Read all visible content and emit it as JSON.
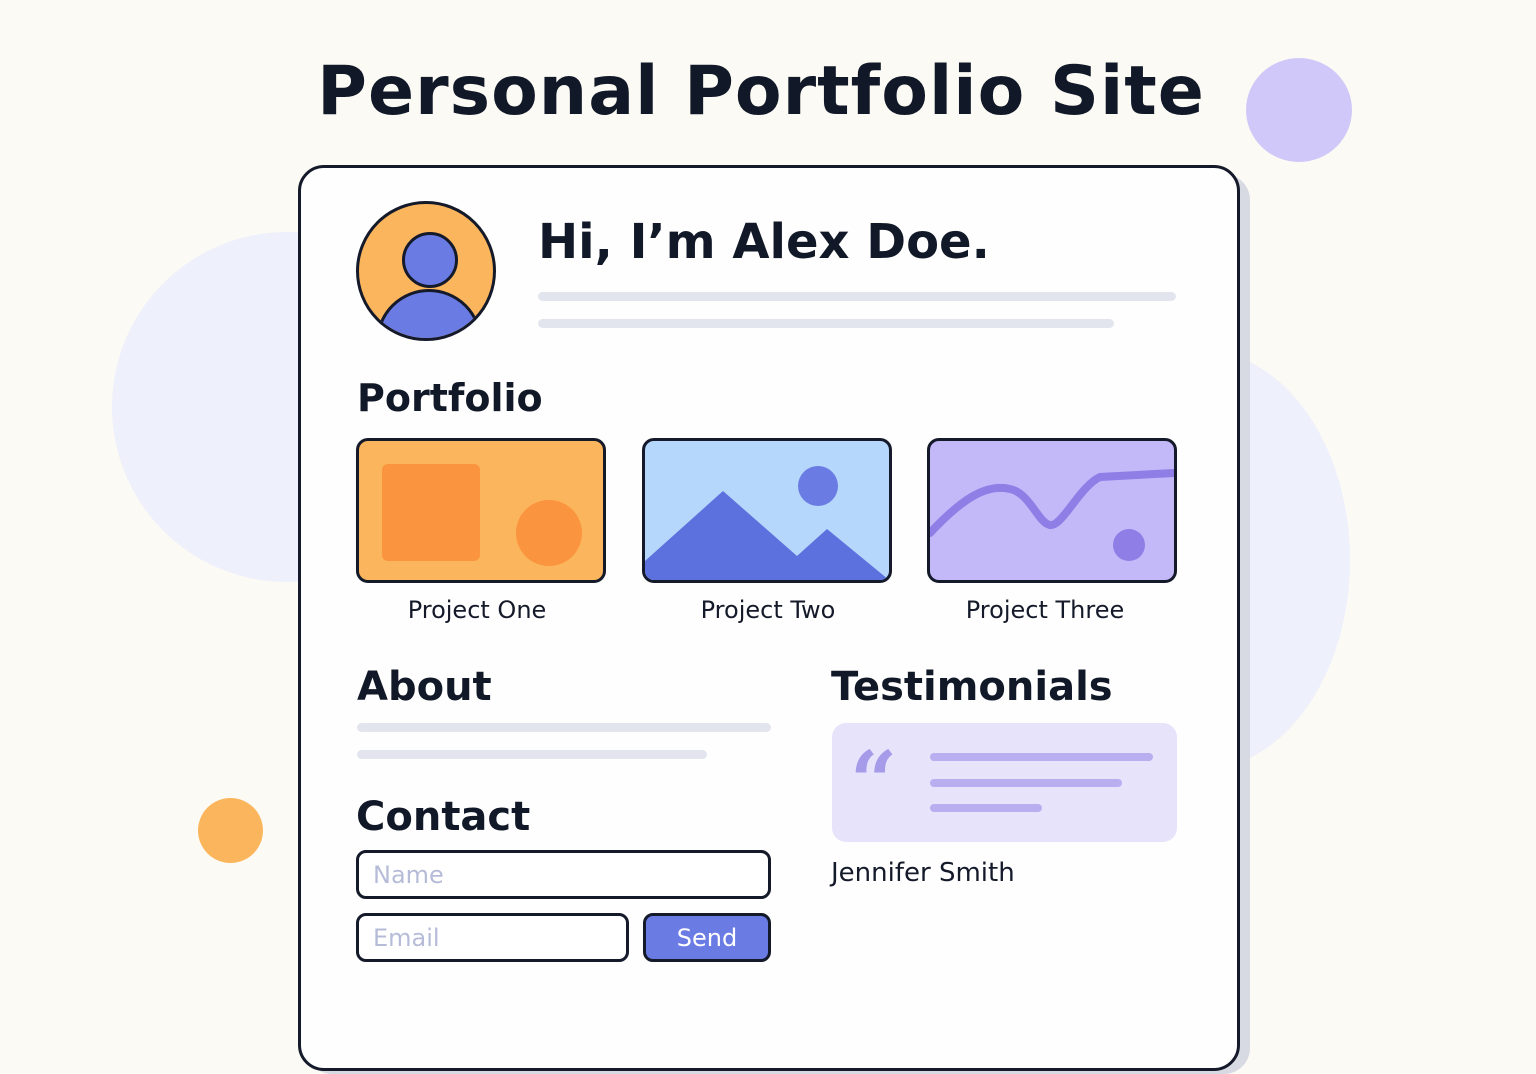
{
  "page": {
    "title": "Personal Portfolio Site"
  },
  "hero": {
    "greeting": "Hi, I’m Alex Doe."
  },
  "portfolio": {
    "heading": "Portfolio",
    "projects": [
      {
        "label": "Project One"
      },
      {
        "label": "Project Two"
      },
      {
        "label": "Project Three"
      }
    ]
  },
  "about": {
    "heading": "About"
  },
  "contact": {
    "heading": "Contact",
    "name_placeholder": "Name",
    "email_placeholder": "Email",
    "send_label": "Send"
  },
  "testimonials": {
    "heading": "Testimonials",
    "quote_glyph": "“",
    "author": "Jennifer Smith"
  },
  "colors": {
    "background": "#fcfaf5",
    "accent_blue": "#6a7be4",
    "accent_orange": "#fbb55c",
    "accent_purple": "#c3b8f8",
    "outline": "#151a2b"
  },
  "icons": {
    "avatar": "user-avatar-icon",
    "quote": "quote-icon",
    "project_one": "shapes-image-icon",
    "project_two": "mountain-image-icon",
    "project_three": "line-graph-image-icon"
  }
}
